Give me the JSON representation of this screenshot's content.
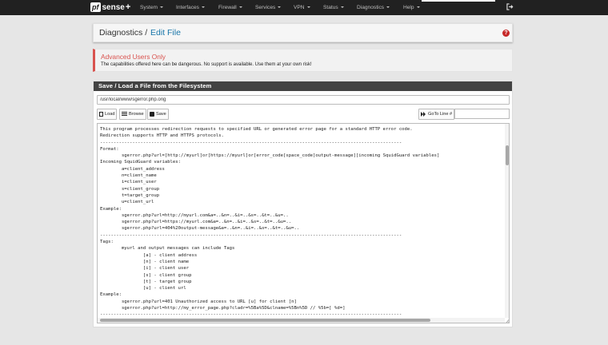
{
  "navbar": {
    "brand": {
      "pf": "pf",
      "sense": "sense",
      "plus": "+"
    },
    "items": [
      {
        "label": "System"
      },
      {
        "label": "Interfaces"
      },
      {
        "label": "Firewall"
      },
      {
        "label": "Services"
      },
      {
        "label": "VPN"
      },
      {
        "label": "Status"
      },
      {
        "label": "Diagnostics"
      },
      {
        "label": "Help"
      }
    ],
    "logout_icon": "sign-out-icon"
  },
  "breadcrumb": {
    "root": "Diagnostics",
    "separator": "/",
    "current": "Edit File",
    "help_label": "?"
  },
  "alert": {
    "title": "Advanced Users Only",
    "text": "The capabilities offered here can be dangerous. No support is available. Use them at your own risk!"
  },
  "panel": {
    "title": "Save / Load a File from the Filesystem",
    "path_value": "/usr/local/www/sgerror.php.orig",
    "buttons": {
      "load": "Load",
      "browse": "Browse",
      "save": "Save",
      "goto": "GoTo Line #"
    },
    "goto_value": ""
  },
  "editor": {
    "lines": [
      "This program processes redirection requests to specified URL or generated error page for a standard HTTP error code.",
      "Redirection supports HTTP and HTTPS protocols.",
      "----------------------------------------------------------------------------------------------------------------",
      "Format:",
      "        sgerror.php?url=[http://myurl]or[https://myurl]or[error_code[space_code]output-message][incoming SquidGuard variables]",
      "Incoming SquidGuard variables:",
      "        a=client_address",
      "        n=client_name",
      "        i=client_user",
      "        s=client_group",
      "        t=target_group",
      "        u=client_url",
      "Example:",
      "        sgerror.php?url=http://myurl.com&a=..&n=..&i=..&s=..&t=..&u=..",
      "        sgerror.php?url=https://myurl.com&a=..&n=..&i=..&s=..&t=..&u=..",
      "        sgerror.php?url=404%20output-message&a=..&n=..&i=..&s=..&t=..&u=..",
      "----------------------------------------------------------------------------------------------------------------",
      "Tags:",
      "        myurl and output messages can include Tags",
      "                [a] - client address",
      "                [n] - client name",
      "                [i] - client user",
      "                [s] - client group",
      "                [t] - target group",
      "                [u] - client url",
      "Example:",
      "        sgerror.php?url=401 Unauthorized access to URL [u] for client [n]",
      "        sgerror.php?url=http://my_error_page.php?cladr=%5Ba%5D&clname=%5Bn%5D // %5b=[ %d=]",
      "----------------------------------------------------------------------------------------------------------------"
    ]
  },
  "colors": {
    "navbar": "#212121",
    "accent_link": "#1976a9",
    "danger": "#d9534f",
    "panel_heading": "#424242"
  }
}
